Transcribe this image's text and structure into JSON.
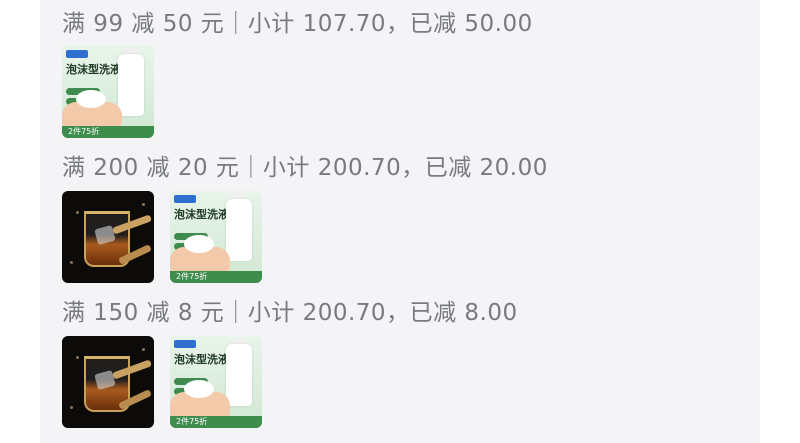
{
  "promos": [
    {
      "label": "满 99 减 50 元｜小计 107.70，已减 50.00"
    },
    {
      "label": "满 200 减 20 元｜小计 200.70，已减 20.00"
    },
    {
      "label": "满 150 减 8 元｜小计 200.70，已减 8.00"
    }
  ],
  "product_foam": {
    "icon": "foam-cleanser-product-image",
    "title": "泡沫型洗液",
    "badge": "2件75折"
  },
  "product_glass": {
    "icon": "whiskey-glass-product-image"
  }
}
